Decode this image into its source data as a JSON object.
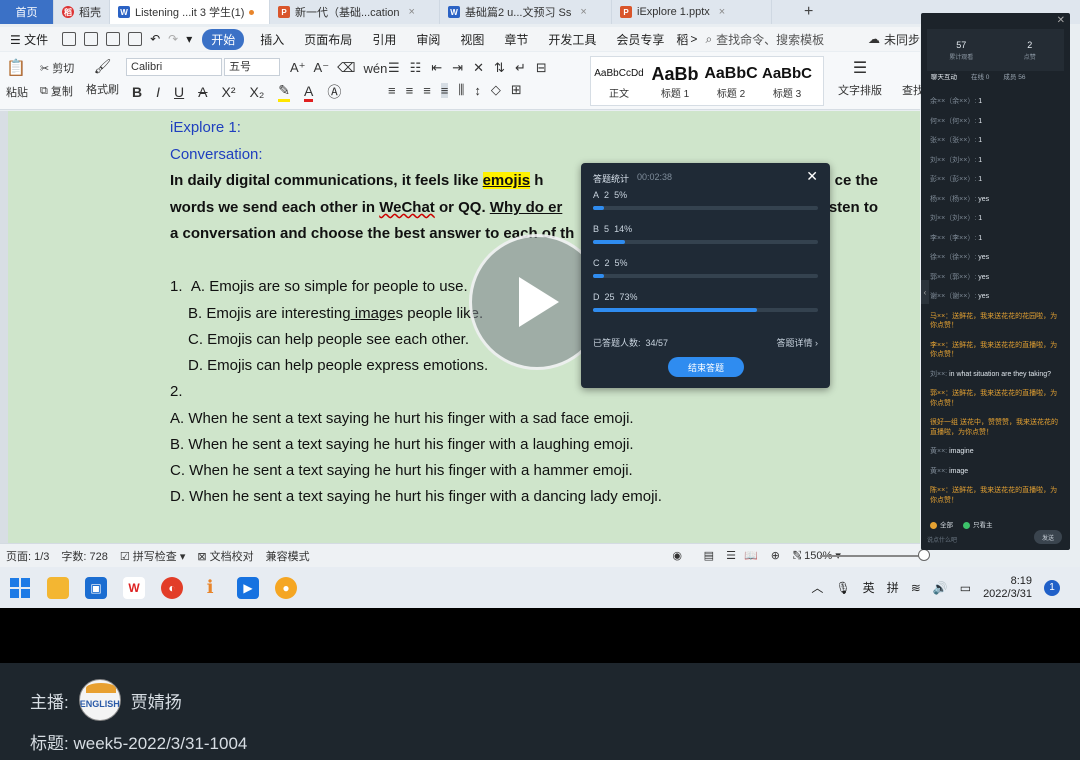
{
  "browser": {
    "tabs": [
      {
        "label": "首页"
      },
      {
        "label": "稻壳"
      },
      {
        "label": "Listening ...it 3 学生(1)"
      },
      {
        "label": "新一代（基础...cation"
      },
      {
        "label": "基础篇2 u...文预习 Ss"
      },
      {
        "label": "iExplore 1.pptx"
      }
    ],
    "plus": "+"
  },
  "menu": {
    "file": "文件",
    "start": "开始",
    "items": [
      "插入",
      "页面布局",
      "引用",
      "审阅",
      "视图",
      "章节",
      "开发工具",
      "会员专享",
      "稻"
    ],
    "more": ">",
    "search": "查找命令、搜索模板",
    "sync": "未同步"
  },
  "ribbon": {
    "paste": "粘贴",
    "cut": "剪切",
    "copy": "复制",
    "format_painter": "格式刷",
    "font": "Calibri",
    "size": "五号",
    "styles": [
      {
        "preview": "AaBbCcDd",
        "name": "正文"
      },
      {
        "preview": "AaBb",
        "name": "标题 1"
      },
      {
        "preview": "AaBbC",
        "name": "标题 2"
      },
      {
        "preview": "AaBbC",
        "name": "标题 3"
      }
    ],
    "text_layout": "文字排版",
    "find": "查找"
  },
  "document": {
    "heading1": "iExplore 1:",
    "heading2": "Conversation:",
    "p1a": "In daily digital communications, it feels like ",
    "p1_hl": "emojis",
    "p1b": " h",
    "p1c": "ce the",
    "p2a": "words we send each other in ",
    "p2_wechat": "WeChat",
    "p2b": " or QQ. ",
    "p2_ul": "Why do er",
    "p2c": "sten to",
    "p3": "a conversation and choose the best answer to each of th",
    "q1_num": "1.",
    "q1_a": "A. Emojis are so simple for people to use.",
    "q1_b_pre": "B.  Emojis are interesting",
    "q1_b_ul": " image",
    "q1_b_post": "s people like.",
    "q1_c": "C. Emojis can help people see each other.",
    "q1_d": "D. Emojis can help people express emotions.",
    "q2_num": "2.",
    "q2_a": "A.  When he sent a text saying he hurt his finger with a sad face emoji.",
    "q2_b": "B.  When he sent a text saying he hurt his finger with a laughing emoji.",
    "q2_c": "C.  When he sent a text saying he hurt his finger with a hammer emoji.",
    "q2_d": "D.  When he sent a text saying he hurt his finger with a dancing lady emoji."
  },
  "statusbar": {
    "page": "页面: 1/3",
    "words": "字数: 728",
    "spell": "拼写检查",
    "doc_check": "文档校对",
    "compat": "兼容模式",
    "zoom": "150%"
  },
  "taskbar": {
    "ime_lang": "英",
    "ime_mode": "拼",
    "time": "8:19",
    "date": "2022/3/31",
    "notifications": "1"
  },
  "popup": {
    "title": "答题统计",
    "time": "00:02:38",
    "options": [
      {
        "label": "A",
        "count": "2",
        "percent": "5%",
        "value": 0.05
      },
      {
        "label": "B",
        "count": "5",
        "percent": "14%",
        "value": 0.14
      },
      {
        "label": "C",
        "count": "2",
        "percent": "5%",
        "value": 0.05
      },
      {
        "label": "D",
        "count": "25",
        "percent": "73%",
        "value": 0.73
      }
    ],
    "answered_label": "已答题人数:",
    "answered_value": "34/57",
    "details": "答题详情",
    "end_button": "结束答题"
  },
  "panel": {
    "stats": [
      {
        "num": "57",
        "label": "累计观看"
      },
      {
        "num": "2",
        "label": "点赞"
      }
    ],
    "tabs": [
      "聊天互动",
      "在线 0",
      "成员 56"
    ],
    "messages": [
      {
        "name": "余××（余××）:",
        "text": "1",
        "gift": false
      },
      {
        "name": "何××（何××）:",
        "text": "1",
        "gift": false
      },
      {
        "name": "张××（张××）:",
        "text": "1",
        "gift": false
      },
      {
        "name": "刘××（刘××）:",
        "text": "1",
        "gift": false
      },
      {
        "name": "彭××（彭××）:",
        "text": "1",
        "gift": false
      },
      {
        "name": "杨××（杨××）:",
        "text": "yes",
        "gift": false
      },
      {
        "name": "刘××（刘××）:",
        "text": "1",
        "gift": false
      },
      {
        "name": "李××（李××）:",
        "text": "1",
        "gift": false
      },
      {
        "name": "徐××（徐××）:",
        "text": "yes",
        "gift": false
      },
      {
        "name": "郭××（郭××）:",
        "text": "yes",
        "gift": false
      },
      {
        "name": "谢××（谢××）:",
        "text": "yes",
        "gift": false
      },
      {
        "name": "",
        "text": "马××：送鲜花，我来送花花的花园啦，为你点赞！",
        "gift": true
      },
      {
        "name": "",
        "text": "李××：送鲜花，我来送花花的直播啦，为你点赞！",
        "gift": true
      },
      {
        "name": "刘××:",
        "text": "in what situation are they taking?",
        "gift": false
      },
      {
        "name": "",
        "text": "郭××：送鲜花，我来送花花的直播啦，为你点赞！",
        "gift": true
      },
      {
        "name": "",
        "text": "很好一组 送花中，赞赞赞，我来送花花的直播啦，为你点赞！",
        "gift": true
      },
      {
        "name": "黄××:",
        "text": "imagine",
        "gift": false
      },
      {
        "name": "黄××:",
        "text": "image",
        "gift": false
      },
      {
        "name": "",
        "text": "陈××：送鲜花，我来送花花的直播啦，为你点赞！",
        "gift": true
      }
    ],
    "legend": [
      {
        "label": "全部",
        "color": "#e5a232"
      },
      {
        "label": "只看主",
        "color": "#3cc26a"
      }
    ],
    "input_placeholder": "说点什么吧",
    "send": "发送"
  },
  "footer": {
    "anchor_label": "主播:",
    "anchor_name": "贾婧扬",
    "avatar_text": "ENGLISH",
    "title_label": "标题:",
    "title_value": "week5-2022/3/31-1004"
  },
  "colors": {
    "accent": "#3b71c6",
    "doc_bg": "#cfe5cb",
    "popup_bg": "#1f2a36",
    "bar_fill": "#2f8cf0",
    "footer_bg": "#1e262d"
  }
}
